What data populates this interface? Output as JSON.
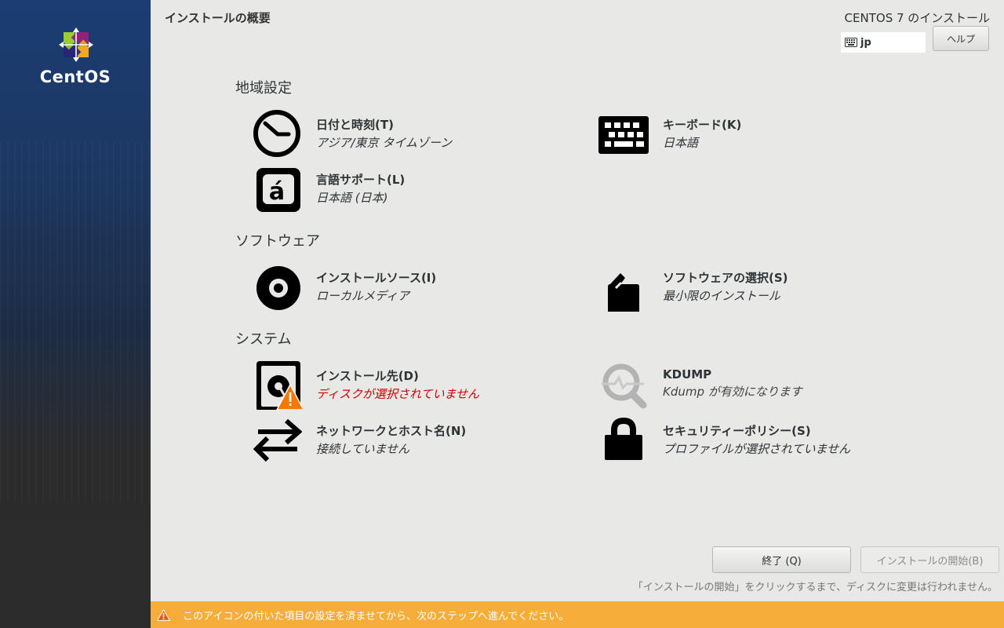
{
  "brand": {
    "logo_text": "CentOS"
  },
  "header": {
    "title": "インストールの概要",
    "product": "CENTOS 7 のインストール",
    "keyboard_layout": "jp",
    "help_label": "ヘルプ"
  },
  "sections": {
    "localization": "地域設定",
    "software": "ソフトウェア",
    "system": "システム"
  },
  "spokes": {
    "datetime": {
      "name": "日付と時刻(T)",
      "status": "アジア/東京 タイムゾーン"
    },
    "keyboard": {
      "name": "キーボード(K)",
      "status": "日本語"
    },
    "language": {
      "name": "言語サポート(L)",
      "status": "日本語 (日本)"
    },
    "source": {
      "name": "インストールソース(I)",
      "status": "ローカルメディア"
    },
    "selection": {
      "name": "ソフトウェアの選択(S)",
      "status": "最小限のインストール"
    },
    "destination": {
      "name": "インストール先(D)",
      "status": "ディスクが選択されていません"
    },
    "kdump": {
      "name": "KDUMP",
      "status": "Kdump が有効になります"
    },
    "network": {
      "name": "ネットワークとホスト名(N)",
      "status": "接続していません"
    },
    "security": {
      "name": "セキュリティーポリシー(S)",
      "status": "プロファイルが選択されていません"
    }
  },
  "footer": {
    "quit_label": "終了 (Q)",
    "begin_label": "インストールの開始(B)",
    "note": "「インストールの開始」をクリックするまで、ディスクに変更は行われません。",
    "warning": "このアイコンの付いた項目の設定を済ませてから、次のステップへ進んでください。"
  },
  "colors": {
    "warning_bar": "#f6ad3a",
    "error_text": "#cc0000",
    "sidebar_top": "#1b3d73"
  }
}
